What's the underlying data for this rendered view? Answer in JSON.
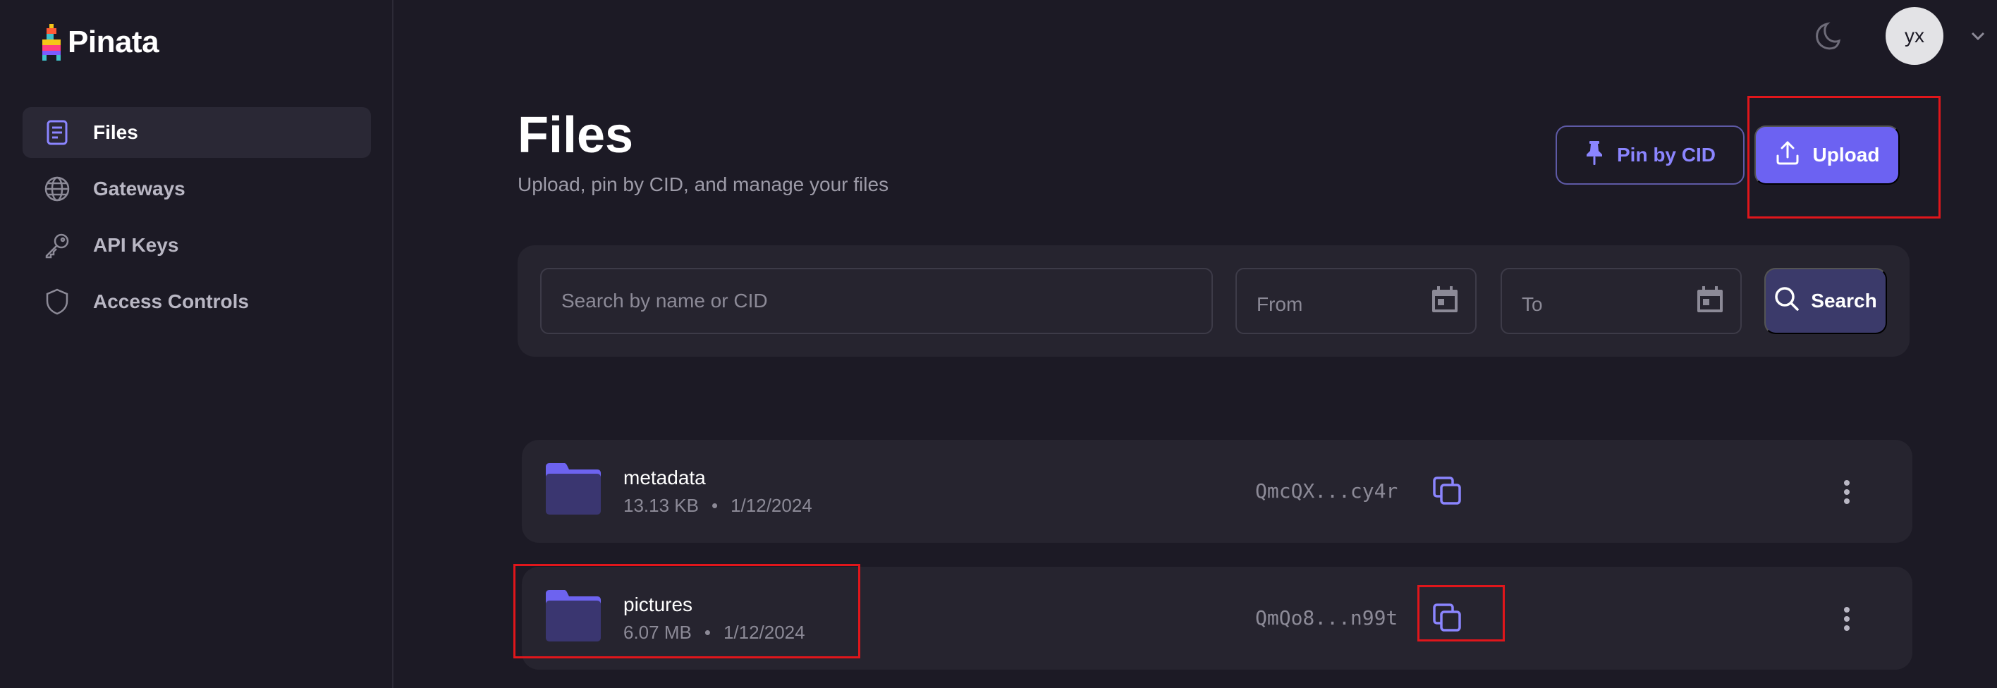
{
  "app": {
    "name": "Pinata"
  },
  "sidebar": {
    "items": [
      {
        "label": "Files",
        "icon": "file-icon",
        "active": true
      },
      {
        "label": "Gateways",
        "icon": "globe-icon",
        "active": false
      },
      {
        "label": "API Keys",
        "icon": "key-icon",
        "active": false
      },
      {
        "label": "Access Controls",
        "icon": "shield-icon",
        "active": false
      }
    ]
  },
  "topbar": {
    "theme_icon": "moon-icon",
    "avatar_initials": "yx",
    "avatar_menu_icon": "chevron-down-icon"
  },
  "header": {
    "title": "Files",
    "subtitle": "Upload, pin by CID, and manage your files",
    "pin_button": "Pin by CID",
    "upload_button": "Upload"
  },
  "search": {
    "placeholder": "Search by name or CID",
    "from_placeholder": "From",
    "to_placeholder": "To",
    "button": "Search"
  },
  "files": [
    {
      "name": "metadata",
      "size": "13.13 KB",
      "date": "1/12/2024",
      "cid": "QmcQX...cy4r"
    },
    {
      "name": "pictures",
      "size": "6.07 MB",
      "date": "1/12/2024",
      "cid": "QmQo8...n99t"
    }
  ],
  "colors": {
    "background": "#1c1a25",
    "panel": "#26242f",
    "accent": "#6c62f2",
    "accent_text": "#8b85ff",
    "highlight": "#e0161b"
  }
}
